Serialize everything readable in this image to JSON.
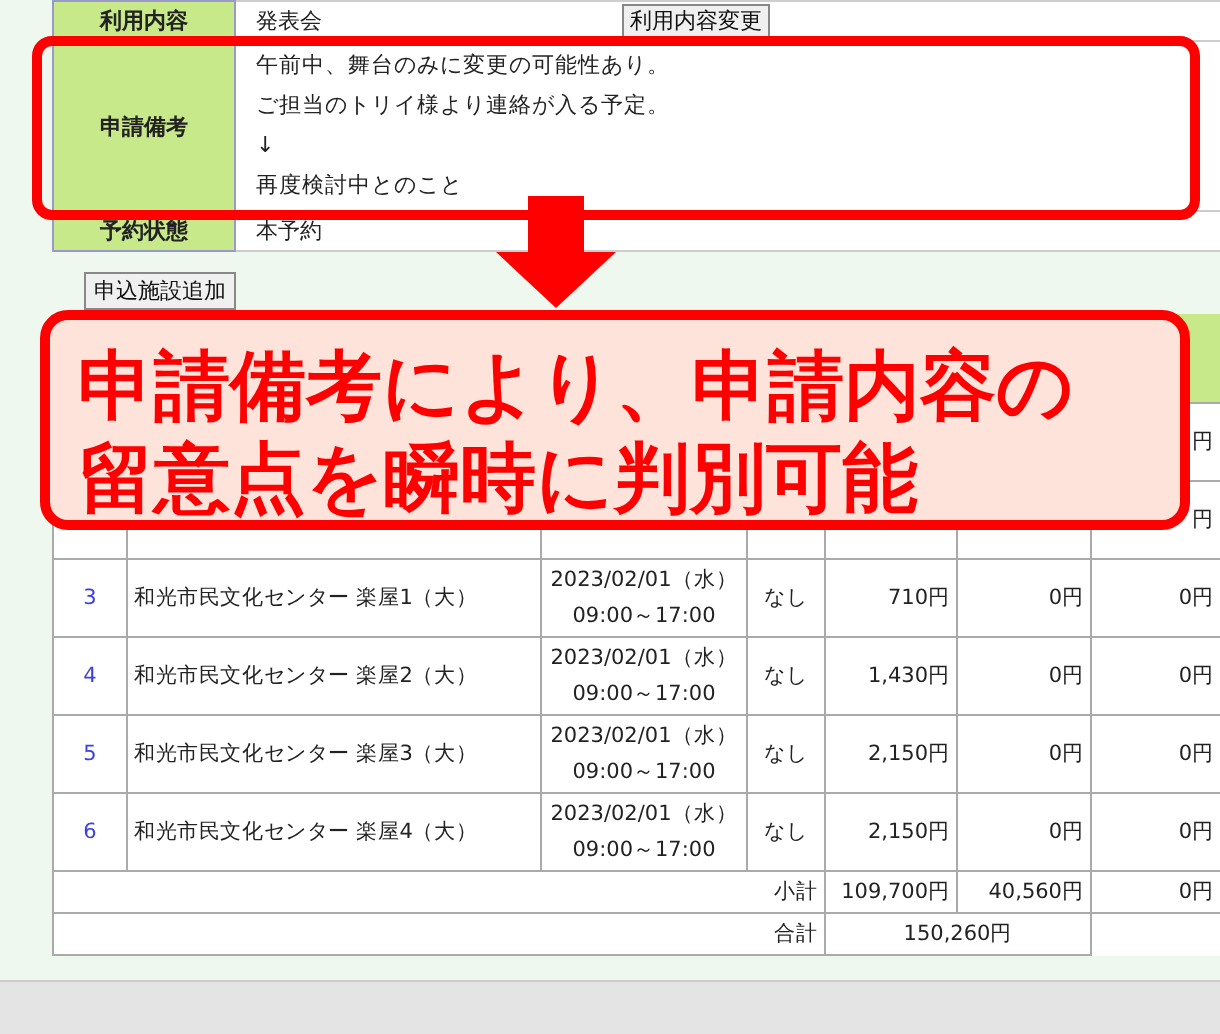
{
  "form": {
    "rows": [
      {
        "kind": "value",
        "label": "利用内容",
        "value": "発表会",
        "button": "利用内容変更"
      },
      {
        "kind": "lines",
        "label": "申請備考",
        "lines": [
          "午前中、舞台のみに変更の可能性あり。",
          "ご担当のトリイ様より連絡が入る予定。",
          "↓",
          "再度検討中とのこと"
        ]
      },
      {
        "kind": "value",
        "label": "予約状態",
        "value": "本予約"
      }
    ]
  },
  "add_button": "申込施設追加",
  "facilities": {
    "hidden_rows": [
      {
        "column_7": "円"
      },
      {
        "column_7": "円"
      }
    ],
    "rows": [
      {
        "no": "3",
        "facility": "和光市民文化センター 楽屋1（大）",
        "date": "2023/02/01（水）",
        "time": "09:00～17:00",
        "option": "なし",
        "fee": "710円",
        "column_6": "0円",
        "column_7": "0円"
      },
      {
        "no": "4",
        "facility": "和光市民文化センター 楽屋2（大）",
        "date": "2023/02/01（水）",
        "time": "09:00～17:00",
        "option": "なし",
        "fee": "1,430円",
        "column_6": "0円",
        "column_7": "0円"
      },
      {
        "no": "5",
        "facility": "和光市民文化センター 楽屋3（大）",
        "date": "2023/02/01（水）",
        "time": "09:00～17:00",
        "option": "なし",
        "fee": "2,150円",
        "column_6": "0円",
        "column_7": "0円"
      },
      {
        "no": "6",
        "facility": "和光市民文化センター 楽屋4（大）",
        "date": "2023/02/01（水）",
        "time": "09:00～17:00",
        "option": "なし",
        "fee": "2,150円",
        "column_6": "0円",
        "column_7": "0円"
      }
    ],
    "subtotal": {
      "label": "小計",
      "values": [
        "109,700円",
        "40,560円",
        "0円"
      ]
    },
    "total": {
      "label": "合計",
      "value": "150,260円"
    }
  },
  "callout": {
    "text": "申請備考により、申請内容の留意点を瞬時に判別可能"
  }
}
